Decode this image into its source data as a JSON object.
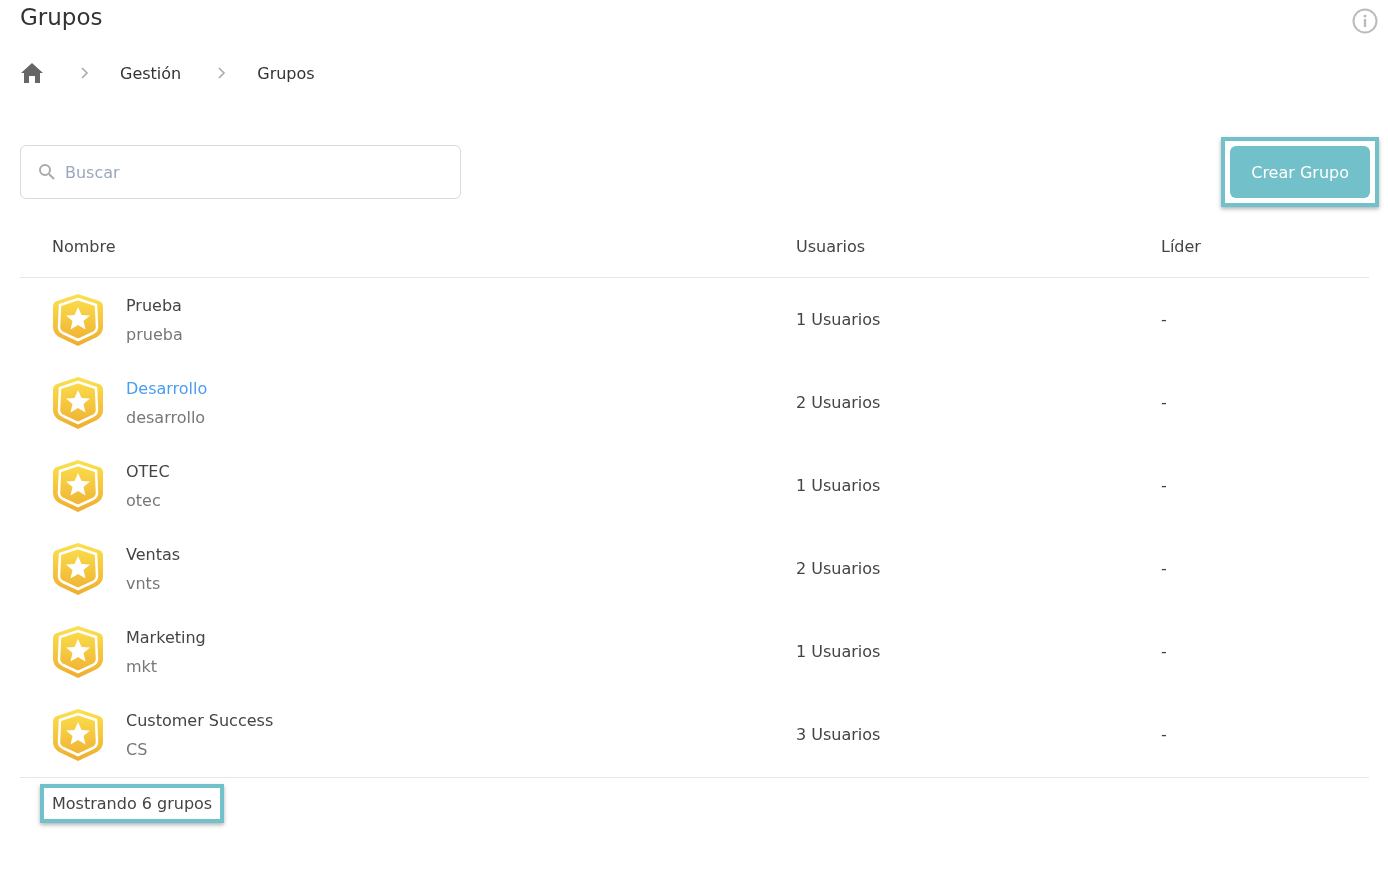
{
  "page": {
    "title": "Grupos"
  },
  "breadcrumb": [
    "Gestión",
    "Grupos"
  ],
  "search": {
    "placeholder": "Buscar"
  },
  "create_button": {
    "label": "Crear Grupo",
    "highlighted": true
  },
  "table": {
    "columns": [
      "Nombre",
      "Usuarios",
      "Líder"
    ],
    "rows": [
      {
        "name": "Prueba",
        "slug": "prueba",
        "users": "1 Usuarios",
        "leader": "-",
        "hovered": false
      },
      {
        "name": "Desarrollo",
        "slug": "desarrollo",
        "users": "2 Usuarios",
        "leader": "-",
        "hovered": true
      },
      {
        "name": "OTEC",
        "slug": "otec",
        "users": "1 Usuarios",
        "leader": "-",
        "hovered": false
      },
      {
        "name": "Ventas",
        "slug": "vnts",
        "users": "2 Usuarios",
        "leader": "-",
        "hovered": false
      },
      {
        "name": "Marketing",
        "slug": "mkt",
        "users": "1 Usuarios",
        "leader": "-",
        "hovered": false
      },
      {
        "name": "Customer Success",
        "slug": "CS",
        "users": "3 Usuarios",
        "leader": "-",
        "hovered": false
      }
    ]
  },
  "footer": {
    "text": "Mostrando 6 grupos",
    "highlighted": true
  }
}
